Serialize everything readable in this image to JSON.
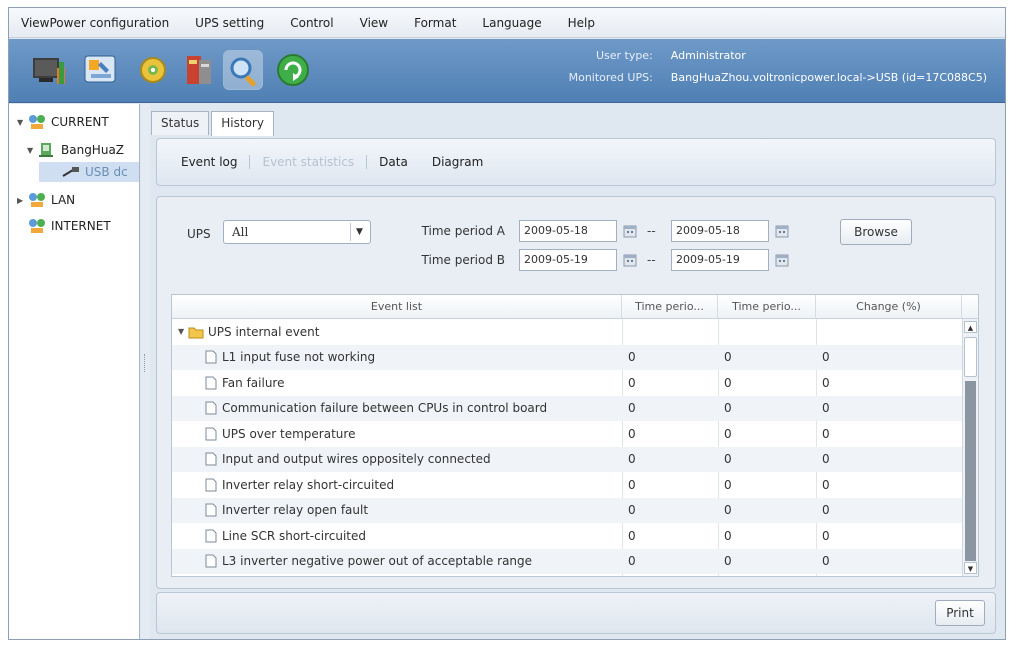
{
  "menu": [
    "ViewPower configuration",
    "UPS setting",
    "Control",
    "View",
    "Format",
    "Language",
    "Help"
  ],
  "toolbar": {
    "icons": [
      "monitor-icon",
      "configuration-icon",
      "gear-icon",
      "ups-icon",
      "search-icon",
      "refresh-icon"
    ],
    "user_type_label": "User type:",
    "user_type_value": "Administrator",
    "monitored_label": "Monitored UPS:",
    "monitored_value": "BangHuaZhou.voltronicpower.local->USB (id=17C088C5)"
  },
  "tree": {
    "current": "CURRENT",
    "host": "BangHuaZ",
    "usb": "USB dc",
    "lan": "LAN",
    "internet": "INTERNET"
  },
  "tabs": [
    "Status",
    "History"
  ],
  "subnav": [
    "Event log",
    "Event statistics",
    "Data",
    "Diagram"
  ],
  "filter": {
    "ups_label": "UPS",
    "ups_value": "All",
    "period_a_label": "Time period A",
    "period_a_from": "2009-05-18",
    "period_a_to": "2009-05-18",
    "period_b_label": "Time period B",
    "period_b_from": "2009-05-19",
    "period_b_to": "2009-05-19",
    "range_sep": "--",
    "browse_label": "Browse"
  },
  "table": {
    "headers": [
      "Event list",
      "Time perio...",
      "Time perio...",
      "Change (%)"
    ],
    "group": "UPS internal event",
    "rows": [
      {
        "name": "L1 input fuse not working",
        "a": "0",
        "b": "0",
        "c": "0"
      },
      {
        "name": "Fan failure",
        "a": "0",
        "b": "0",
        "c": "0"
      },
      {
        "name": "Communication failure between CPUs in control board",
        "a": "0",
        "b": "0",
        "c": "0"
      },
      {
        "name": "UPS over temperature",
        "a": "0",
        "b": "0",
        "c": "0"
      },
      {
        "name": "Input and output wires oppositely connected",
        "a": "0",
        "b": "0",
        "c": "0"
      },
      {
        "name": "Inverter relay short-circuited",
        "a": "0",
        "b": "0",
        "c": "0"
      },
      {
        "name": "Inverter relay open fault",
        "a": "0",
        "b": "0",
        "c": "0"
      },
      {
        "name": "Line SCR short-circuited",
        "a": "0",
        "b": "0",
        "c": "0"
      },
      {
        "name": "L3 inverter negative power out of acceptable range",
        "a": "0",
        "b": "0",
        "c": "0"
      }
    ]
  },
  "print_label": "Print"
}
